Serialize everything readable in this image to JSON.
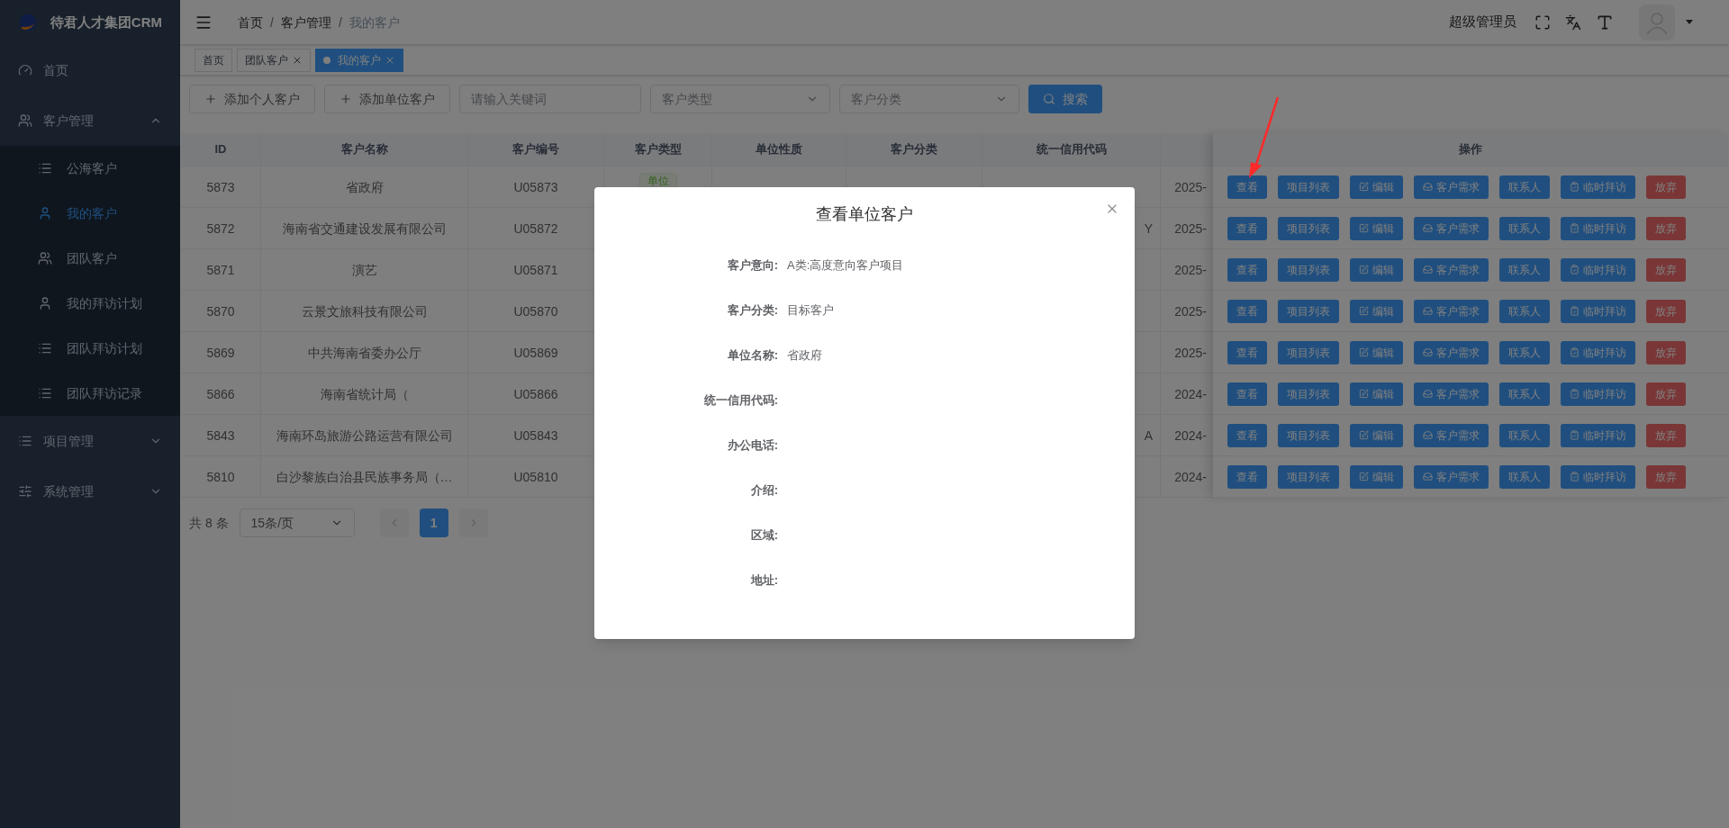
{
  "app": {
    "title": "待君人才集团CRM"
  },
  "sidebar": {
    "items": [
      {
        "label": "首页",
        "kind": "home",
        "selected": false
      },
      {
        "label": "客户管理",
        "kind": "group",
        "expanded": true,
        "selected": false,
        "children": [
          {
            "label": "公海客户",
            "kind": "list",
            "selected": false
          },
          {
            "label": "我的客户",
            "kind": "user",
            "selected": true
          },
          {
            "label": "团队客户",
            "kind": "users",
            "selected": false
          },
          {
            "label": "我的拜访计划",
            "kind": "user",
            "selected": false
          },
          {
            "label": "团队拜访计划",
            "kind": "list",
            "selected": false
          },
          {
            "label": "团队拜访记录",
            "kind": "list",
            "selected": false
          }
        ]
      },
      {
        "label": "项目管理",
        "kind": "list",
        "expanded": false,
        "selected": false
      },
      {
        "label": "系统管理",
        "kind": "sliders",
        "expanded": false,
        "selected": false
      }
    ]
  },
  "header": {
    "breadcrumb": [
      {
        "text": "首页",
        "kind": "link"
      },
      {
        "text": "/",
        "kind": "separator"
      },
      {
        "text": "客户管理",
        "kind": "link"
      },
      {
        "text": "/",
        "kind": "separator"
      },
      {
        "text": "我的客户",
        "kind": "current"
      }
    ],
    "user": "超级管理员"
  },
  "tabs": [
    {
      "label": "首页",
      "closable": false,
      "selected": false
    },
    {
      "label": "团队客户",
      "closable": true,
      "selected": false
    },
    {
      "label": "我的客户",
      "closable": true,
      "selected": true
    }
  ],
  "toolbar": {
    "buttons": [
      "添加个人客户",
      "添加单位客户"
    ],
    "keyword": {
      "placeholder": "请输入关键词"
    },
    "selects": [
      {
        "placeholder": "客户类型"
      },
      {
        "placeholder": "客户分类"
      }
    ],
    "search": "搜索"
  },
  "table": {
    "columns": [
      "ID",
      "客户名称",
      "客户编号",
      "客户类型",
      "单位性质",
      "客户分类",
      "统一信用代码",
      "",
      "操作"
    ],
    "rows": [
      {
        "id": "5873",
        "name": "省政府",
        "code": "U05873",
        "type": "单位",
        "nature": "",
        "category": "",
        "credit": "",
        "date": "2025-",
        "actions": [
          {
            "label": "查看",
            "kind": "plain"
          },
          {
            "label": "项目列表",
            "kind": "plain"
          },
          {
            "label": "编辑",
            "kind": "edit"
          },
          {
            "label": "客户需求",
            "kind": "demand"
          },
          {
            "label": "联系人",
            "kind": "plain"
          },
          {
            "label": "临时拜访",
            "kind": "visit"
          },
          {
            "label": "放弃",
            "kind": "danger"
          }
        ]
      },
      {
        "id": "5872",
        "name": "海南省交通建设发展有限公司",
        "code": "U05872",
        "type": "",
        "nature": "",
        "category": "",
        "credit": "Y",
        "date": "2025-",
        "actions": [
          {
            "label": "查看",
            "kind": "plain"
          },
          {
            "label": "项目列表",
            "kind": "plain"
          },
          {
            "label": "编辑",
            "kind": "edit"
          },
          {
            "label": "客户需求",
            "kind": "demand"
          },
          {
            "label": "联系人",
            "kind": "plain"
          },
          {
            "label": "临时拜访",
            "kind": "visit"
          },
          {
            "label": "放弃",
            "kind": "danger"
          }
        ]
      },
      {
        "id": "5871",
        "name": "演艺",
        "code": "U05871",
        "type": "",
        "nature": "",
        "category": "",
        "credit": "",
        "date": "2025-",
        "actions": [
          {
            "label": "查看",
            "kind": "plain"
          },
          {
            "label": "项目列表",
            "kind": "plain"
          },
          {
            "label": "编辑",
            "kind": "edit"
          },
          {
            "label": "客户需求",
            "kind": "demand"
          },
          {
            "label": "联系人",
            "kind": "plain"
          },
          {
            "label": "临时拜访",
            "kind": "visit"
          },
          {
            "label": "放弃",
            "kind": "danger"
          }
        ]
      },
      {
        "id": "5870",
        "name": "云景文旅科技有限公司",
        "code": "U05870",
        "type": "",
        "nature": "",
        "category": "",
        "credit": "",
        "date": "2025-",
        "actions": [
          {
            "label": "查看",
            "kind": "plain"
          },
          {
            "label": "项目列表",
            "kind": "plain"
          },
          {
            "label": "编辑",
            "kind": "edit"
          },
          {
            "label": "客户需求",
            "kind": "demand"
          },
          {
            "label": "联系人",
            "kind": "plain"
          },
          {
            "label": "临时拜访",
            "kind": "visit"
          },
          {
            "label": "放弃",
            "kind": "danger"
          }
        ]
      },
      {
        "id": "5869",
        "name": "中共海南省委办公厅",
        "code": "U05869",
        "type": "",
        "nature": "",
        "category": "",
        "credit": "",
        "date": "2025-",
        "actions": [
          {
            "label": "查看",
            "kind": "plain"
          },
          {
            "label": "项目列表",
            "kind": "plain"
          },
          {
            "label": "编辑",
            "kind": "edit"
          },
          {
            "label": "客户需求",
            "kind": "demand"
          },
          {
            "label": "联系人",
            "kind": "plain"
          },
          {
            "label": "临时拜访",
            "kind": "visit"
          },
          {
            "label": "放弃",
            "kind": "danger"
          }
        ]
      },
      {
        "id": "5866",
        "name": "海南省统计局（",
        "code": "U05866",
        "type": "",
        "nature": "",
        "category": "",
        "credit": "",
        "date": "2024-",
        "actions": [
          {
            "label": "查看",
            "kind": "plain"
          },
          {
            "label": "项目列表",
            "kind": "plain"
          },
          {
            "label": "编辑",
            "kind": "edit"
          },
          {
            "label": "客户需求",
            "kind": "demand"
          },
          {
            "label": "联系人",
            "kind": "plain"
          },
          {
            "label": "临时拜访",
            "kind": "visit"
          },
          {
            "label": "放弃",
            "kind": "danger"
          }
        ]
      },
      {
        "id": "5843",
        "name": "海南环岛旅游公路运营有限公司",
        "code": "U05843",
        "type": "",
        "nature": "",
        "category": "",
        "credit": "A",
        "date": "2024-",
        "actions": [
          {
            "label": "查看",
            "kind": "plain"
          },
          {
            "label": "项目列表",
            "kind": "plain"
          },
          {
            "label": "编辑",
            "kind": "edit"
          },
          {
            "label": "客户需求",
            "kind": "demand"
          },
          {
            "label": "联系人",
            "kind": "plain"
          },
          {
            "label": "临时拜访",
            "kind": "visit"
          },
          {
            "label": "放弃",
            "kind": "danger"
          }
        ]
      },
      {
        "id": "5810",
        "name": "白沙黎族白治县民族事务局（…",
        "code": "U05810",
        "type": "",
        "nature": "",
        "category": "",
        "credit": "",
        "date": "2024-",
        "actions": [
          {
            "label": "查看",
            "kind": "plain"
          },
          {
            "label": "项目列表",
            "kind": "plain"
          },
          {
            "label": "编辑",
            "kind": "edit"
          },
          {
            "label": "客户需求",
            "kind": "demand"
          },
          {
            "label": "联系人",
            "kind": "plain"
          },
          {
            "label": "临时拜访",
            "kind": "visit"
          },
          {
            "label": "放弃",
            "kind": "danger"
          }
        ]
      }
    ]
  },
  "pagination": {
    "total": "共 8 条",
    "page_size": "15条/页",
    "pages": [
      {
        "label": "1",
        "selected": true
      }
    ]
  },
  "modal": {
    "title": "查看单位客户",
    "fields": [
      {
        "label": "客户意向:",
        "value": "A类:高度意向客户项目"
      },
      {
        "label": "客户分类:",
        "value": "目标客户"
      },
      {
        "label": "单位名称:",
        "value": "省政府"
      },
      {
        "label": "统一信用代码:"
      },
      {
        "label": "办公电话:"
      },
      {
        "label": "介绍:"
      },
      {
        "label": "区域:"
      },
      {
        "label": "地址:"
      }
    ]
  }
}
